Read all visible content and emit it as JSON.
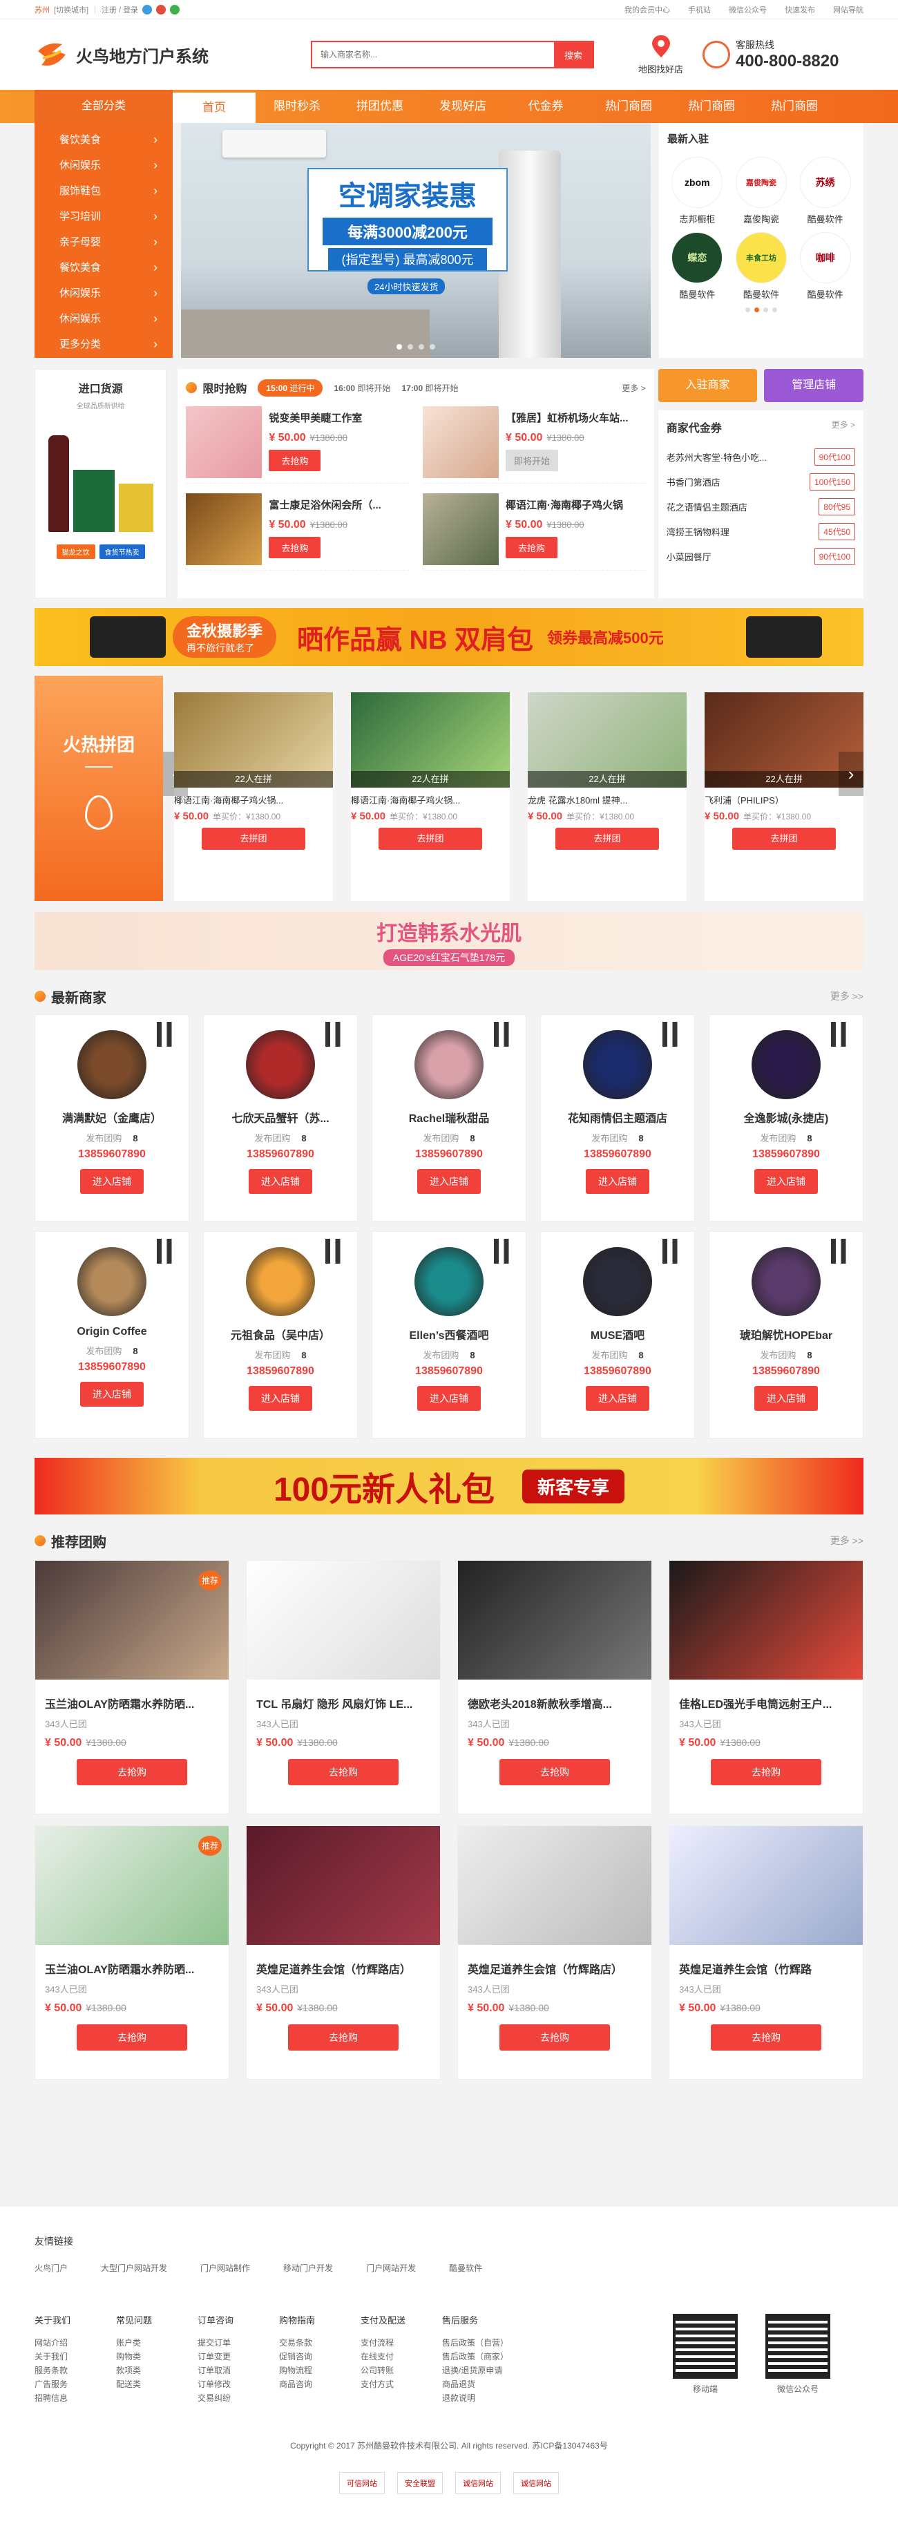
{
  "topbar": {
    "city": "苏州",
    "switch_city": "[切换城市]",
    "login": "注册 / 登录",
    "member": "我的会员中心",
    "mobile": "手机站",
    "wechat": "微信公众号",
    "publish": "快速发布",
    "nav": "网站导航"
  },
  "header": {
    "site_name": "火鸟地方门户系统",
    "search_placeholder": "输入商家名称...",
    "search_button": "搜索",
    "map_label": "地图找好店",
    "hotline_label": "客服热线",
    "hotline_number": "400-800-8820"
  },
  "nav": {
    "all": "全部分类",
    "items": [
      "首页",
      "限时秒杀",
      "拼团优惠",
      "发现好店",
      "代金券",
      "热门商圈",
      "热门商圈",
      "热门商圈"
    ]
  },
  "categories": [
    "餐饮美食",
    "休闲娱乐",
    "服饰鞋包",
    "学习培训",
    "亲子母婴",
    "餐饮美食",
    "休闲娱乐",
    "休闲娱乐",
    "更多分类"
  ],
  "banner": {
    "title": "空调家装惠",
    "line1": "每满3000减200元",
    "line2": "(指定型号) 最高减800元",
    "tag": "24小时快速发货"
  },
  "new_shops": {
    "title": "最新入驻",
    "items": [
      {
        "logo": "zbom",
        "name": "志邦橱柜"
      },
      {
        "logo": "嘉俊陶瓷",
        "name": "嘉俊陶瓷"
      },
      {
        "logo": "苏绣",
        "name": "酷曼软件"
      },
      {
        "logo": "蝶恋",
        "name": "酷曼软件"
      },
      {
        "logo": "丰食工坊",
        "name": "酷曼软件"
      },
      {
        "logo": "咖啡",
        "name": "酷曼软件"
      }
    ]
  },
  "source": {
    "title": "进口货源",
    "subtitle": "全球品质新供给",
    "btn1": "猫龙之饮",
    "btn2": "食货节热卖"
  },
  "flash": {
    "title": "限时抢购",
    "tabs": [
      {
        "time": "15:00",
        "state": "进行中"
      },
      {
        "time": "16:00",
        "state": "即将开始"
      },
      {
        "time": "17:00",
        "state": "即将开始"
      }
    ],
    "more": "更多 >",
    "items": [
      {
        "name": "锐变美甲美睫工作室",
        "price": "¥ 50.00",
        "orig": "¥1380.00",
        "btn": "去抢购"
      },
      {
        "name": "【雅居】虹桥机场火车站...",
        "price": "¥ 50.00",
        "orig": "¥1380.00",
        "btn": "即将开始"
      },
      {
        "name": "富士康足浴休闲会所（...",
        "price": "¥ 50.00",
        "orig": "¥1380.00",
        "btn": "去抢购"
      },
      {
        "name": "椰语江南·海南椰子鸡火锅",
        "price": "¥ 50.00",
        "orig": "¥1380.00",
        "btn": "去抢购"
      }
    ]
  },
  "side": {
    "join": "入驻商家",
    "manage": "管理店铺",
    "coupon_title": "商家代金券",
    "more": "更多 >",
    "coupons": [
      {
        "name": "老苏州大客堂·特色小吃...",
        "value": "90代100"
      },
      {
        "name": "书香门第酒店",
        "value": "100代150"
      },
      {
        "name": "花之语情侣主题酒店",
        "value": "80代95"
      },
      {
        "name": "湾捞王锅物料理",
        "value": "45代50"
      },
      {
        "name": "小菜园餐厅",
        "value": "90代100"
      }
    ]
  },
  "ad1": {
    "left": "金秋摄影季",
    "left_sub": "再不旅行就老了",
    "main": "晒作品赢",
    "brand": "双肩包",
    "right": "领券最高减500元"
  },
  "hot_group": {
    "title": "火热拼团",
    "items": [
      {
        "label": "22人在拼",
        "name": "椰语江南·海南椰子鸡火锅...",
        "price": "¥ 50.00",
        "orig": "单买价：¥1380.00",
        "btn": "去拼团"
      },
      {
        "label": "22人在拼",
        "name": "椰语江南·海南椰子鸡火锅...",
        "price": "¥ 50.00",
        "orig": "单买价：¥1380.00",
        "btn": "去拼团"
      },
      {
        "label": "22人在拼",
        "name": "龙虎 花露水180ml 提神...",
        "price": "¥ 50.00",
        "orig": "单买价：¥1380.00",
        "btn": "去拼团"
      },
      {
        "label": "22人在拼",
        "name": "飞利浦（PHILIPS）",
        "price": "¥ 50.00",
        "orig": "单买价：¥1380.00",
        "btn": "去拼团"
      }
    ]
  },
  "ad2": {
    "title": "打造韩系水光肌",
    "sub": "AGE20's红宝石气垫178元"
  },
  "merchants": {
    "title": "最新商家",
    "more": "更多 >>",
    "group_label": "发布团购",
    "btn": "进入店铺",
    "items": [
      {
        "name": "满满默妃（金鹰店）",
        "count": "8",
        "phone": "13859607890"
      },
      {
        "name": "七欣天品蟹轩（苏...",
        "count": "8",
        "phone": "13859607890"
      },
      {
        "name": "Rachel瑞秋甜品",
        "count": "8",
        "phone": "13859607890"
      },
      {
        "name": "花知雨情侣主题酒店",
        "count": "8",
        "phone": "13859607890"
      },
      {
        "name": "全逸影城(永捷店)",
        "count": "8",
        "phone": "13859607890"
      },
      {
        "name": "Origin Coffee",
        "count": "8",
        "phone": "13859607890"
      },
      {
        "name": "元祖食品（吴中店）",
        "count": "8",
        "phone": "13859607890"
      },
      {
        "name": "Ellen’s西餐酒吧",
        "count": "8",
        "phone": "13859607890"
      },
      {
        "name": "MUSE酒吧",
        "count": "8",
        "phone": "13859607890"
      },
      {
        "name": "琥珀解忧HOPEbar",
        "count": "8",
        "phone": "13859607890"
      }
    ]
  },
  "ad3": {
    "title": "100元新人礼包",
    "btn": "新客专享"
  },
  "recommend": {
    "title": "推荐团购",
    "more": "更多 >>",
    "btn": "去抢购",
    "badge": "推荐",
    "items": [
      {
        "name": "玉兰油OLAY防晒霜水养防晒...",
        "sold": "343人已团",
        "price": "¥ 50.00",
        "orig": "¥1380.00",
        "badge": true
      },
      {
        "name": "TCL 吊扇灯 隐形 风扇灯饰 LE...",
        "sold": "343人已团",
        "price": "¥ 50.00",
        "orig": "¥1380.00",
        "badge": false
      },
      {
        "name": "德欧老头2018新款秋季增高...",
        "sold": "343人已团",
        "price": "¥ 50.00",
        "orig": "¥1380.00",
        "badge": false
      },
      {
        "name": "佳格LED强光手电筒远射王户...",
        "sold": "343人已团",
        "price": "¥ 50.00",
        "orig": "¥1380.00",
        "badge": false
      },
      {
        "name": "玉兰油OLAY防晒霜水养防晒...",
        "sold": "343人已团",
        "price": "¥ 50.00",
        "orig": "¥1380.00",
        "badge": true
      },
      {
        "name": "英煌足道养生会馆（竹辉路店）",
        "sold": "343人已团",
        "price": "¥ 50.00",
        "orig": "¥1380.00",
        "badge": false
      },
      {
        "name": "英煌足道养生会馆（竹辉路店）",
        "sold": "343人已团",
        "price": "¥ 50.00",
        "orig": "¥1380.00",
        "badge": false
      },
      {
        "name": "英煌足道养生会馆（竹辉路",
        "sold": "343人已团",
        "price": "¥ 50.00",
        "orig": "¥1380.00",
        "badge": false
      }
    ]
  },
  "footer": {
    "links_title": "友情链接",
    "links": [
      "火鸟门户",
      "大型门户网站开发",
      "门户网站制作",
      "移动门户开发",
      "门户网站开发",
      "酷曼软件"
    ],
    "cols": [
      {
        "h": "关于我们",
        "items": [
          "网站介绍",
          "关于我们",
          "服务条款",
          "广告服务",
          "招聘信息"
        ]
      },
      {
        "h": "常见问题",
        "items": [
          "账户类",
          "购物类",
          "款项类",
          "配送类"
        ]
      },
      {
        "h": "订单咨询",
        "items": [
          "提交订单",
          "订单变更",
          "订单取消",
          "订单修改",
          "交易纠纷"
        ]
      },
      {
        "h": "购物指南",
        "items": [
          "交易条款",
          "促销咨询",
          "购物流程",
          "商品咨询"
        ]
      },
      {
        "h": "支付及配送",
        "items": [
          "支付流程",
          "在线支付",
          "公司转账",
          "支付方式"
        ]
      },
      {
        "h": "售后服务",
        "items": [
          "售后政策（自营）",
          "售后政策（商家）",
          "退换/退货原申请",
          "商品退货",
          "退款说明"
        ]
      }
    ],
    "qr1": "移动端",
    "qr2": "微信公众号",
    "copyright": "Copyright © 2017 苏州酷曼软件技术有限公司. All rights reserved.   苏ICP备13047463号",
    "certs": [
      "可信网站",
      "安全联盟",
      "诚信网站",
      "诚信网站"
    ]
  },
  "colors": {
    "accent": "#f36a1f",
    "red": "#f2413a",
    "blue": "#1e6bd0"
  }
}
